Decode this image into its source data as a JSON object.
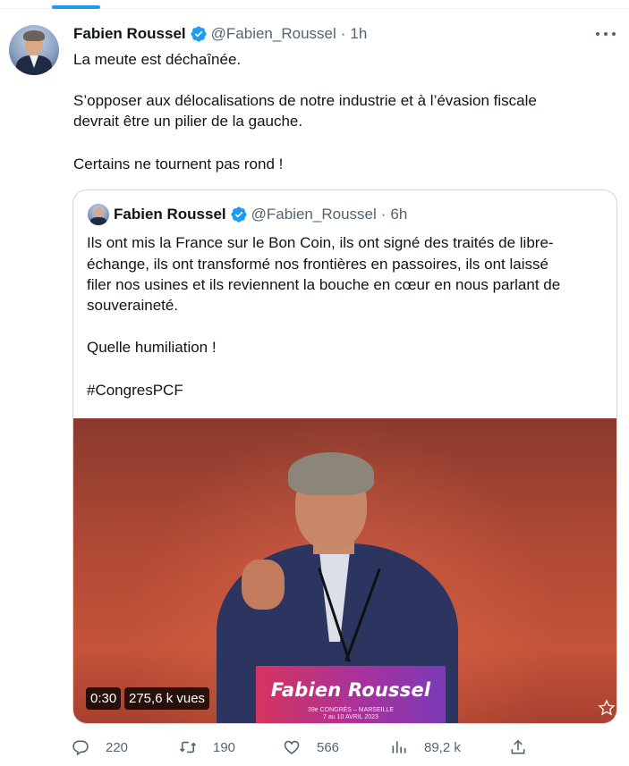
{
  "tweet": {
    "author_name": "Fabien Roussel",
    "handle": "@Fabien_Roussel",
    "separator": "·",
    "time": "1h",
    "text_lines": [
      "La meute est déchaînée.",
      "S’opposer aux délocalisations de notre industrie et à l’évasion fiscale",
      "devrait être un pilier de la gauche.",
      "Certains ne tournent pas rond !"
    ]
  },
  "quoted": {
    "author_name": "Fabien Roussel",
    "handle": "@Fabien_Roussel",
    "separator": "·",
    "time": "6h",
    "text_lines": [
      "Ils ont mis la France sur le Bon Coin, ils ont signé des traités de libre-",
      "échange, ils ont transformé nos frontières en passoires, ils ont laissé",
      "filer nos usines et ils reviennent la bouche en cœur en nous parlant de",
      "souveraineté.",
      "Quelle humiliation !",
      "#CongresPCF"
    ],
    "video": {
      "duration": "0:30",
      "views": "275,6 k vues",
      "lectern_name": "Fabien Roussel",
      "lectern_sub_1": "39e CONGRÈS – MARSEILLE",
      "lectern_sub_2": "7 au 10 AVRIL 2023"
    }
  },
  "actions": {
    "replies": "220",
    "reposts": "190",
    "likes": "566",
    "views": "89,2 k"
  },
  "colors": {
    "accent": "#1d9bf0",
    "text": "#0f1419",
    "muted": "#536471",
    "border": "#cfd9de"
  },
  "icons": [
    "verified-badge-icon",
    "more-icon",
    "reply-icon",
    "repost-icon",
    "like-icon",
    "views-icon",
    "share-icon"
  ]
}
